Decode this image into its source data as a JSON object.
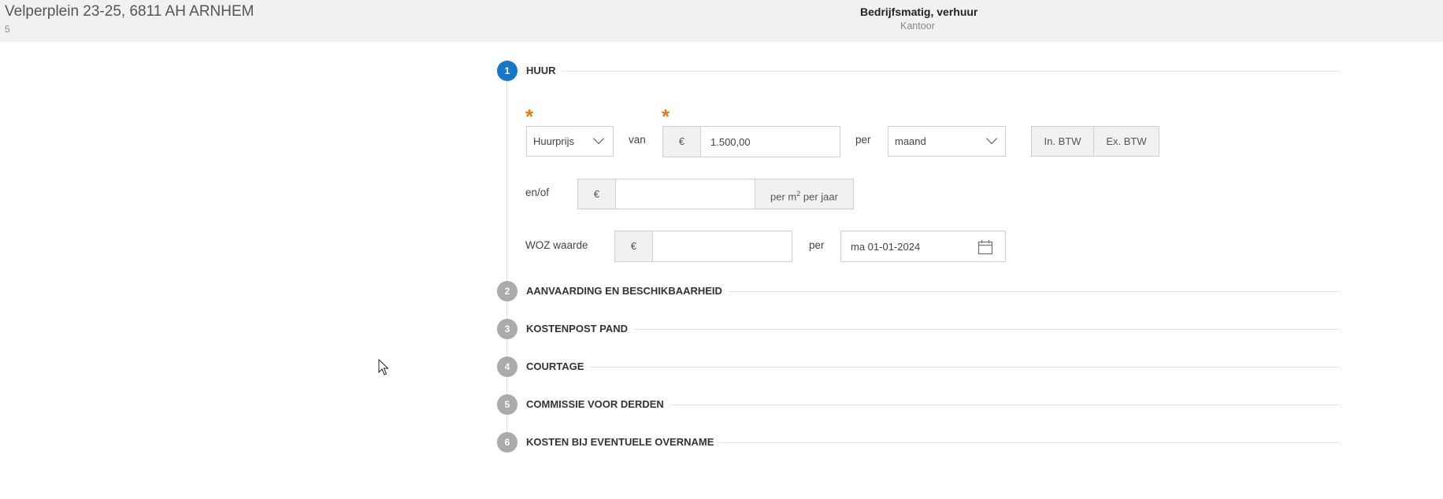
{
  "header": {
    "address": "Velperplein 23-25, 6811 AH ARNHEM",
    "address_sub": "5",
    "property_type": "Bedrijfsmatig, verhuur",
    "property_subtype": "Kantoor"
  },
  "steps": [
    {
      "number": "1",
      "label": "HUUR",
      "active": true
    },
    {
      "number": "2",
      "label": "AANVAARDING EN BESCHIKBAARHEID",
      "active": false
    },
    {
      "number": "3",
      "label": "KOSTENPOST PAND",
      "active": false
    },
    {
      "number": "4",
      "label": "COURTAGE",
      "active": false
    },
    {
      "number": "5",
      "label": "COMMISSIE VOOR DERDEN",
      "active": false
    },
    {
      "number": "6",
      "label": "KOSTEN BIJ EVENTUELE OVERNAME",
      "active": false
    }
  ],
  "huur": {
    "required_mark": "*",
    "price_type": "Huurprijs",
    "van_label": "van",
    "currency": "€",
    "price_value": "1.500,00",
    "per_label": "per",
    "period": "maand",
    "btw_in": "In. BTW",
    "btw_ex": "Ex. BTW",
    "enof_label": "en/of",
    "m2_value": "",
    "m2_unit_prefix": "per m",
    "m2_unit_sup": "2",
    "m2_unit_suffix": " per jaar",
    "woz_label": "WOZ waarde",
    "woz_value": "",
    "date_value": "ma 01-01-2024"
  },
  "icons": {
    "dropdown": "chevron-down-icon",
    "date": "calendar-icon",
    "pointer": "mouse-cursor-icon"
  },
  "colors": {
    "active_step": "#1777c9",
    "inactive_step": "#aaaaaa",
    "required": "#e27b12",
    "header_bg": "#f1f1f1"
  }
}
